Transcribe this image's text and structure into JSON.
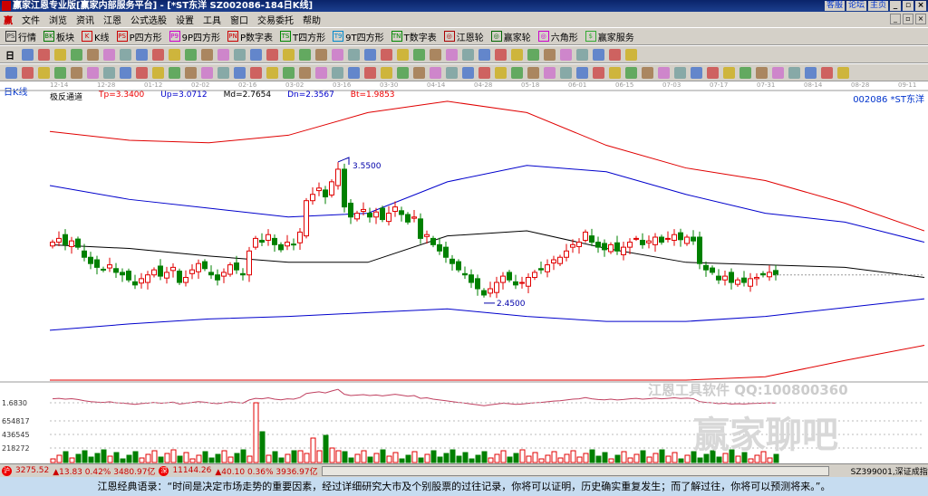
{
  "window": {
    "title": "赢家江恩专业版[赢家内部服务平台] - [*ST东洋   SZ002086-184日K线]",
    "links": [
      "客服",
      "论坛",
      "主页"
    ]
  },
  "menu": [
    "文件",
    "浏览",
    "资讯",
    "江恩",
    "公式选股",
    "设置",
    "工具",
    "窗口",
    "交易委托",
    "帮助"
  ],
  "toolbar1": [
    {
      "icon": "PS",
      "label": "行情"
    },
    {
      "icon": "BK",
      "label": "板块"
    },
    {
      "icon": "K",
      "label": "K线"
    },
    {
      "icon": "PS",
      "label": "P四方形"
    },
    {
      "icon": "P9",
      "label": "9P四方形"
    },
    {
      "icon": "PN",
      "label": "P数字表"
    },
    {
      "icon": "TS",
      "label": "T四方形"
    },
    {
      "icon": "T9",
      "label": "9T四方形"
    },
    {
      "icon": "TN",
      "label": "T数字表"
    },
    {
      "icon": "◎",
      "label": "江恩轮"
    },
    {
      "icon": "◎",
      "label": "赢家轮"
    },
    {
      "icon": "◎",
      "label": "六角形"
    },
    {
      "icon": "$",
      "label": "赢家服务"
    }
  ],
  "toolbar2": {
    "period": "日"
  },
  "date_axis": [
    "12-14",
    "12-28",
    "01-12",
    "02-02",
    "02-16",
    "03-02",
    "03-16",
    "03-30",
    "04-14",
    "04-28",
    "05-18",
    "06-01",
    "06-15",
    "07-03",
    "07-17",
    "07-31",
    "08-14",
    "08-28",
    "09-11"
  ],
  "chart": {
    "period_label": "日K线",
    "indicator": "极反通道",
    "tp": "Tp=3.3400",
    "up": "Up=3.0712",
    "md": "Md=2.7654",
    "dn": "Dn=2.3567",
    "bt": "Bt=1.9853",
    "stock": "002086 *ST东洋",
    "high_label": "3.5500",
    "low_label": "2.4500",
    "colors": {
      "up": "#e00000",
      "down": "#008000",
      "band_outer": "#e00000",
      "band_inner": "#0000cc",
      "mid": "#000000"
    }
  },
  "chart_data": {
    "type": "candlestick",
    "closes": [
      2.92,
      2.95,
      2.9,
      2.93,
      2.88,
      2.8,
      2.75,
      2.72,
      2.7,
      2.74,
      2.68,
      2.66,
      2.62,
      2.58,
      2.63,
      2.66,
      2.7,
      2.65,
      2.68,
      2.72,
      2.6,
      2.64,
      2.7,
      2.75,
      2.71,
      2.66,
      2.62,
      2.68,
      2.74,
      2.7,
      2.66,
      2.85,
      2.95,
      2.92,
      2.98,
      2.9,
      2.86,
      2.92,
      2.9,
      3.0,
      3.25,
      3.3,
      3.35,
      3.28,
      3.4,
      3.5,
      3.2,
      3.12,
      3.15,
      3.18,
      3.12,
      3.16,
      3.1,
      3.15,
      3.2,
      3.14,
      3.08,
      3.12,
      2.95,
      2.98,
      2.9,
      2.85,
      2.8,
      2.75,
      2.7,
      2.66,
      2.6,
      2.55,
      2.5,
      2.55,
      2.6,
      2.65,
      2.62,
      2.58,
      2.6,
      2.64,
      2.68,
      2.7,
      2.74,
      2.78,
      2.8,
      2.85,
      2.9,
      2.92,
      3.0,
      2.92,
      2.88,
      2.86,
      2.9,
      2.85,
      2.88,
      2.92,
      2.95,
      2.9,
      2.93,
      2.96,
      2.92,
      2.95,
      2.98,
      2.94,
      2.96,
      2.93,
      2.75,
      2.7,
      2.68,
      2.62,
      2.65,
      2.6,
      2.62,
      2.6,
      2.63,
      2.64,
      2.66,
      2.68,
      2.66
    ],
    "bands": {
      "upper_outer": [
        3.8,
        3.73,
        3.71,
        3.77,
        3.95,
        4.04,
        3.95,
        3.69,
        3.51,
        3.41,
        3.23,
        3.01
      ],
      "upper_inner": [
        3.37,
        3.26,
        3.19,
        3.12,
        3.15,
        3.4,
        3.53,
        3.48,
        3.3,
        3.15,
        3.08,
        2.92
      ],
      "mid": [
        2.9,
        2.87,
        2.81,
        2.76,
        2.76,
        2.97,
        3.01,
        2.87,
        2.76,
        2.74,
        2.72,
        2.64
      ],
      "lower_inner": [
        2.22,
        2.27,
        2.31,
        2.33,
        2.36,
        2.39,
        2.33,
        2.29,
        2.29,
        2.33,
        2.4,
        2.47
      ],
      "lower_outer": [
        1.7,
        1.72,
        1.74,
        1.75,
        1.75,
        1.78,
        1.72,
        1.7,
        1.75,
        1.85,
        1.98,
        2.1
      ]
    },
    "volume_axis": [
      "1.6830",
      "654817",
      "436545",
      "218272"
    ]
  },
  "watermark": {
    "text": "江恩工具软件   QQ:100800360",
    "brand": "赢家聊吧"
  },
  "status": {
    "sh": "3275.52",
    "sh_chg": "▲13.83 0.42% 3480.97亿",
    "sz": "11144.26",
    "sz_chg": "▲40.10 0.36% 3936.97亿",
    "index": "SZ399001,深证成指"
  },
  "quote": "江恩经典语录：“时间是决定市场走势的重要因素，经过详细研究大市及个别股票的过往记录，你将可以证明，历史确实重复发生；而了解过往，你将可以预测将来。”。"
}
